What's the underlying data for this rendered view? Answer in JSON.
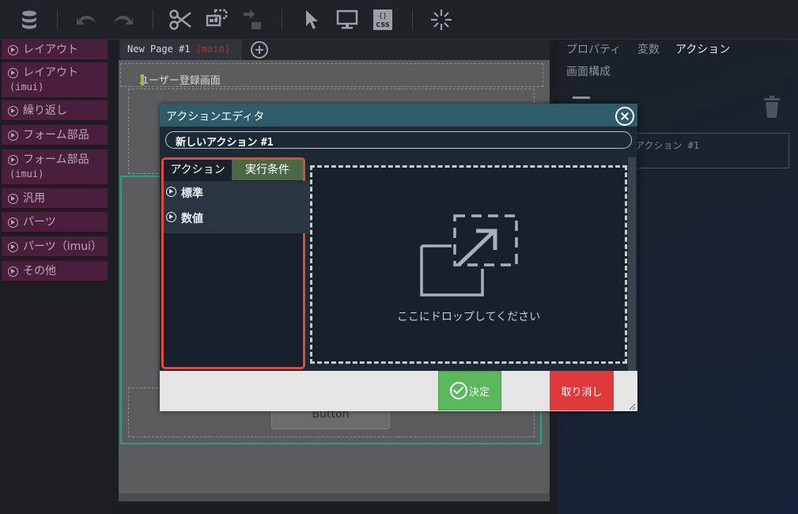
{
  "toolbar": {
    "icons": [
      "database-icon",
      "undo-icon",
      "redo-icon",
      "cut-icon",
      "structure-icon",
      "swap-icon",
      "pointer-icon",
      "monitor-icon",
      "css-icon",
      "sparkle-icon"
    ],
    "css_label": "CSS",
    "css_braces": "{}"
  },
  "sidebar": {
    "items": [
      {
        "label": "レイアウト",
        "sub": ""
      },
      {
        "label": "レイアウト",
        "sub": "(imui)"
      },
      {
        "label": "繰り返し",
        "sub": ""
      },
      {
        "label": "フォーム部品",
        "sub": ""
      },
      {
        "label": "フォーム部品",
        "sub": "(imui)"
      },
      {
        "label": "汎用",
        "sub": ""
      },
      {
        "label": "パーツ",
        "sub": ""
      },
      {
        "label": "パーツ（imui）",
        "sub": ""
      },
      {
        "label": "その他",
        "sub": ""
      }
    ]
  },
  "editor": {
    "tab_label": "New Page #1",
    "tab_suffix": "[main]",
    "screen_title": "ユーザー登録画面",
    "bg_button_label": "Button"
  },
  "right_panel": {
    "tabs": [
      "プロパティ",
      "変数",
      "アクション"
    ],
    "tab2": "画面構成",
    "action_name_preview": "アクション #1"
  },
  "modal": {
    "title": "アクションエディタ",
    "action_name_prefix": "新しいアクション",
    "action_name_suffix": "#1",
    "tabs": {
      "action": "アクション",
      "condition": "実行条件"
    },
    "categories": [
      "標準",
      "数値"
    ],
    "drop_text": "ここにドロップしてください",
    "ok_label": "決定",
    "cancel_label": "取り消し"
  },
  "colors": {
    "palette_border": "#e04a3b",
    "ok": "#5cb85c",
    "cancel": "#e0393b",
    "title_bar": "#2e5c6b",
    "sidebar_item": "#4a1f3b"
  }
}
